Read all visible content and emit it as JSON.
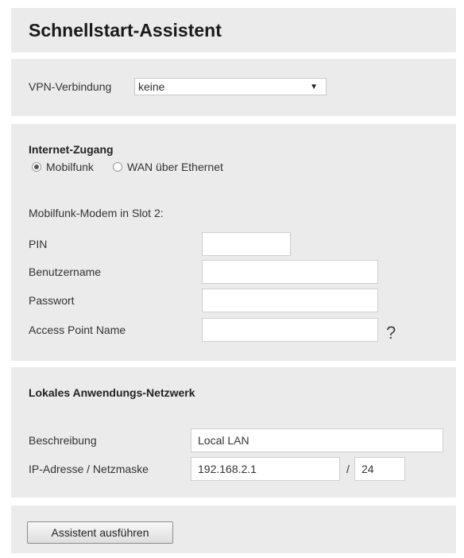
{
  "title": "Schnellstart-Assistent",
  "vpn": {
    "label": "VPN-Verbindung",
    "selected": "keine"
  },
  "internet": {
    "heading": "Internet-Zugang",
    "options": [
      {
        "label": "Mobilfunk",
        "checked": true
      },
      {
        "label": "WAN über Ethernet",
        "checked": false
      }
    ],
    "modem_label": "Mobilfunk-Modem in Slot 2:",
    "fields": {
      "pin": {
        "label": "PIN",
        "value": ""
      },
      "username": {
        "label": "Benutzername",
        "value": ""
      },
      "password": {
        "label": "Passwort",
        "value": ""
      },
      "apn": {
        "label": "Access Point Name",
        "value": ""
      }
    },
    "help": "?"
  },
  "lan": {
    "heading": "Lokales Anwendungs-Netzwerk",
    "description_label": "Beschreibung",
    "description_value": "Local LAN",
    "ip_label": "IP-Adresse / Netzmaske",
    "ip_value": "192.168.2.1",
    "separator": "/",
    "mask_value": "24"
  },
  "button_label": "Assistent ausführen"
}
